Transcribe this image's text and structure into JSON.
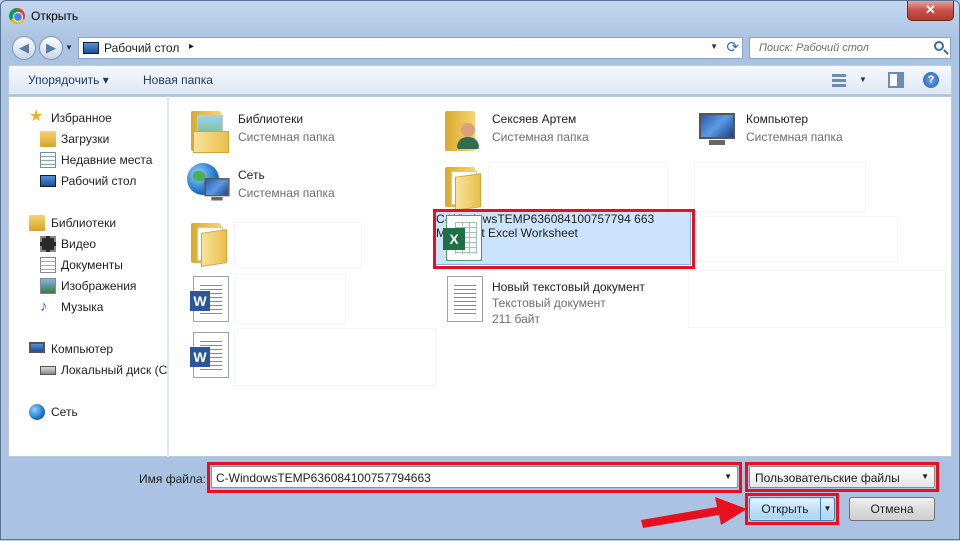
{
  "window": {
    "title": "Открыть",
    "close_label": "✕"
  },
  "nav": {
    "back_icon": "arrow-left-icon",
    "forward_icon": "arrow-right-icon",
    "address_path": "Рабочий стол",
    "address_sep": "▸",
    "search_placeholder": "Поиск: Рабочий стол"
  },
  "toolbar": {
    "organize_label": "Упорядочить ▾",
    "new_folder_label": "Новая папка",
    "help_label": "?"
  },
  "sidebar": {
    "groups": [
      {
        "label": "Избранное",
        "items": [
          "Загрузки",
          "Недавние места",
          "Рабочий стол"
        ]
      },
      {
        "label": "Библиотеки",
        "items": [
          "Видео",
          "Документы",
          "Изображения",
          "Музыка"
        ]
      },
      {
        "label": "Компьютер",
        "items": [
          "Локальный диск (C"
        ]
      },
      {
        "label": "Сеть",
        "items": []
      }
    ]
  },
  "files": [
    {
      "name": "Библиотеки",
      "sub": "Системная папка",
      "icon": "libraries-folder-icon"
    },
    {
      "name": "Сексяев Артем",
      "sub": "Системная папка",
      "icon": "user-folder-icon"
    },
    {
      "name": "Компьютер",
      "sub": "Системная папка",
      "icon": "computer-icon"
    },
    {
      "name": "Сеть",
      "sub": "Системная папка",
      "icon": "network-icon"
    },
    {
      "name": "C-WindowsTEMP636084100757794663",
      "name_line1": "C-WindowsTEMP636084100757794",
      "name_line2": "663",
      "sub": "Microsoft Excel Worksheet",
      "icon": "excel-icon"
    },
    {
      "name": "Новый текстовый документ",
      "sub": "Текстовый документ",
      "size": "211 байт",
      "icon": "text-document-icon"
    }
  ],
  "bottom": {
    "filename_label": "Имя файла:",
    "filename_value": "C-WindowsTEMP636084100757794663",
    "filetype_value": "Пользовательские файлы",
    "open_label": "Открыть",
    "cancel_label": "Отмена"
  },
  "colors": {
    "selection": "#cce4fb",
    "highlight_red": "#e8101f",
    "frame": "#aac3e2"
  }
}
